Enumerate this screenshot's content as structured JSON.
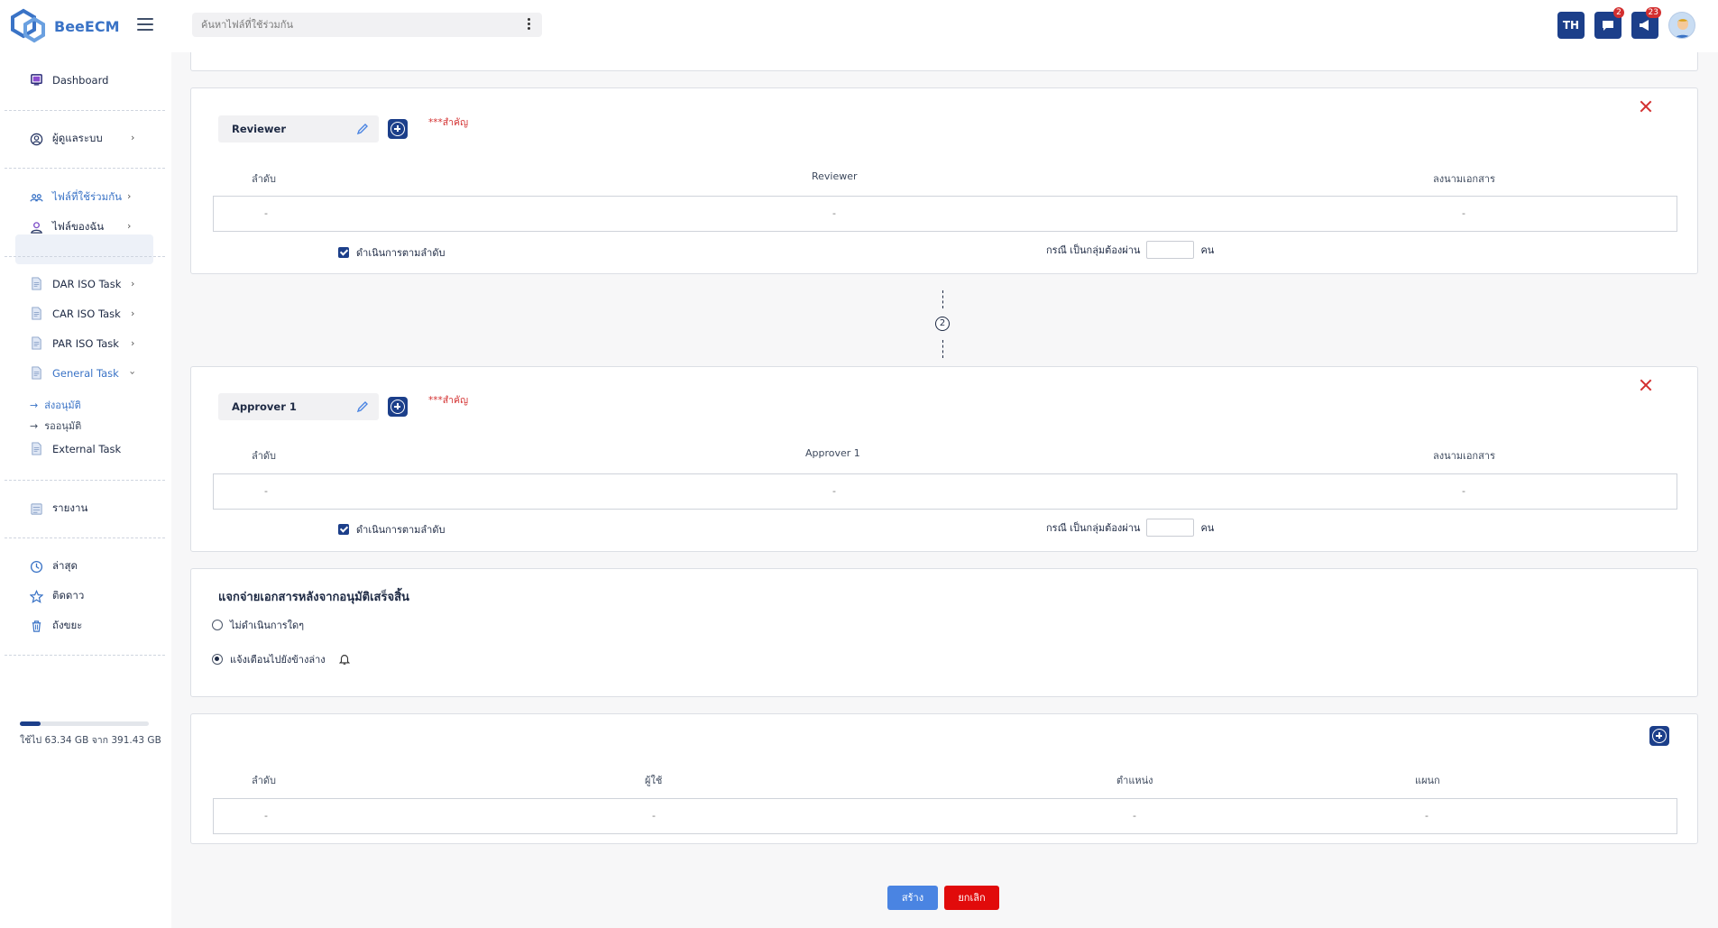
{
  "app": {
    "name": "BeeECM",
    "brand_color": "#3a73c6",
    "accent_color": "#1c3f8a",
    "danger_color": "#d32f2f"
  },
  "search": {
    "placeholder": "ค้นหาไฟล์ที่ใช้ร่วมกัน"
  },
  "topbar": {
    "lang": "TH",
    "chat_badge": "2",
    "notif_badge": "23"
  },
  "sidebar": {
    "dashboard": "Dashboard",
    "users": "ผู้ดูแลระบบ",
    "shared_files": "ไฟล์ที่ใช้ร่วมกัน",
    "my_files": "ไฟล์ของฉัน",
    "dar": "DAR ISO Task",
    "car": "CAR ISO Task",
    "par": "PAR ISO Task",
    "general": "General Task",
    "sub_send": "ส่งอนุมัติ",
    "sub_wait": "รออนุมัติ",
    "external": "External Task",
    "report": "รายงาน",
    "recent": "ล่าสุด",
    "starred": "ติดดาว",
    "trash": "ถังขยะ",
    "storage_text": "ใช้ไป 63.34 GB จาก 391.43 GB",
    "storage_fraction": 0.16
  },
  "reviewer_card": {
    "name": "Reviewer",
    "important": "***สำคัญ",
    "headers": [
      "ลำดับ",
      "Reviewer",
      "ลงนามเอกสาร"
    ],
    "row": [
      "-",
      "-",
      "-"
    ],
    "sequential_label": "ดำเนินการตามลำดับ",
    "group_label": "กรณี เป็นกลุ่มต้องผ่าน",
    "group_unit": "คน",
    "group_value": ""
  },
  "step": {
    "number": "2"
  },
  "approver_card": {
    "name": "Approver 1",
    "important": "***สำคัญ",
    "headers": [
      "ลำดับ",
      "Approver 1",
      "ลงนามเอกสาร"
    ],
    "row": [
      "-",
      "-",
      "-"
    ],
    "sequential_label": "ดำเนินการตามลำดับ",
    "group_label": "กรณี เป็นกลุ่มต้องผ่าน",
    "group_unit": "คน",
    "group_value": ""
  },
  "distribution": {
    "title": "แจกจ่ายเอกสารหลังจากอนุมัติเสร็จสิ้น",
    "option_none": "ไม่ดำเนินการใดๆ",
    "option_notify": "แจ้งเตือนไปยังข้างล่าง",
    "selected": "notify"
  },
  "recipients": {
    "headers": [
      "ลำดับ",
      "ผู้ใช้",
      "ตำแหน่ง",
      "แผนก"
    ],
    "row": [
      "-",
      "-",
      "-",
      "-"
    ]
  },
  "actions": {
    "create": "สร้าง",
    "cancel": "ยกเลิก"
  }
}
